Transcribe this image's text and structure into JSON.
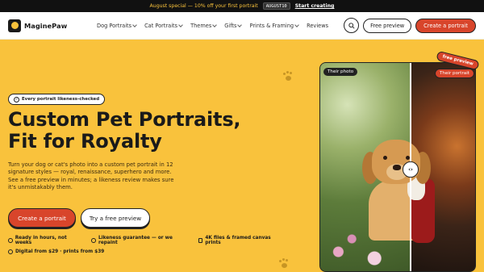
{
  "promo": {
    "message": "August special — 10% off your first portrait",
    "code": "AUGUST10",
    "cta": "Start creating"
  },
  "header": {
    "brand": "MaginePaw",
    "nav": [
      {
        "label": "Dog Portraits",
        "has_menu": true
      },
      {
        "label": "Cat Portraits",
        "has_menu": true
      },
      {
        "label": "Themes",
        "has_menu": true
      },
      {
        "label": "Gifts",
        "has_menu": true
      },
      {
        "label": "Prints & Framing",
        "has_menu": true
      },
      {
        "label": "Reviews",
        "has_menu": false
      }
    ],
    "free_preview": "Free preview",
    "create": "Create a portrait"
  },
  "hero": {
    "badge": "Every portrait likeness-checked",
    "headline_line1": "Custom Pet Portraits,",
    "headline_line2": "Fit for Royalty",
    "description": "Turn your dog or cat's photo into a custom pet portrait in 12 signature styles — royal, renaissance, superhero and more. See a free preview in minutes; a likeness review makes sure it's unmistakably them.",
    "primary_cta": "Create a portrait",
    "secondary_cta": "Try a free preview",
    "features": [
      "Ready in hours, not weeks",
      "Likeness guarantee — or we repaint",
      "4K files & framed canvas prints"
    ],
    "pricing": "Digital from $29 · prints from $39"
  },
  "compare": {
    "before_label": "Their photo",
    "after_label": "Their portrait",
    "sticker": "free preview"
  },
  "colors": {
    "accent": "#d8452b",
    "background": "#f9c23c",
    "dark": "#111111"
  }
}
